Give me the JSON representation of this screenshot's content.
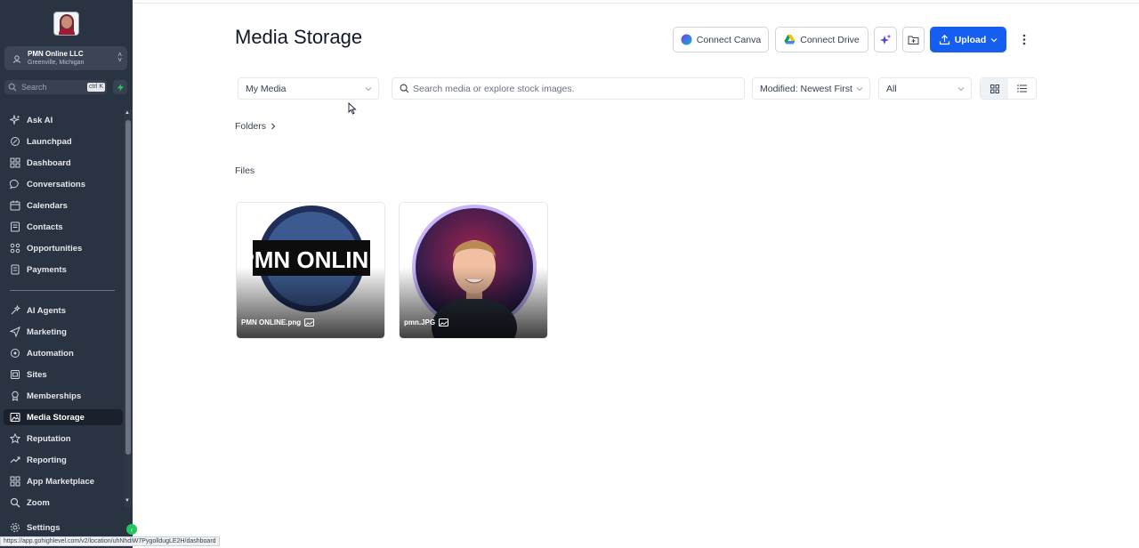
{
  "sidebar": {
    "account": {
      "name": "PMN Online LLC",
      "location": "Greenville, Michigan"
    },
    "search": {
      "placeholder": "Search",
      "shortcut": "ctrl K"
    },
    "nav": [
      {
        "label": "Ask AI",
        "icon": "sparkle-icon"
      },
      {
        "label": "Launchpad",
        "icon": "rocket-icon"
      },
      {
        "label": "Dashboard",
        "icon": "grid-icon"
      },
      {
        "label": "Conversations",
        "icon": "chat-icon"
      },
      {
        "label": "Calendars",
        "icon": "calendar-icon"
      },
      {
        "label": "Contacts",
        "icon": "contacts-icon"
      },
      {
        "label": "Opportunities",
        "icon": "opportunities-icon"
      },
      {
        "label": "Payments",
        "icon": "payments-icon"
      }
    ],
    "nav2": [
      {
        "label": "AI Agents",
        "icon": "ai-agents-icon"
      },
      {
        "label": "Marketing",
        "icon": "send-icon"
      },
      {
        "label": "Automation",
        "icon": "automation-icon"
      },
      {
        "label": "Sites",
        "icon": "sites-icon"
      },
      {
        "label": "Memberships",
        "icon": "award-icon"
      },
      {
        "label": "Media Storage",
        "icon": "image-icon",
        "active": true
      },
      {
        "label": "Reputation",
        "icon": "star-icon"
      },
      {
        "label": "Reporting",
        "icon": "trend-icon"
      },
      {
        "label": "App Marketplace",
        "icon": "apps-icon"
      },
      {
        "label": "Zoom",
        "icon": "zoom-icon"
      }
    ],
    "settings_label": "Settings"
  },
  "status_url": "https://app.gohighlevel.com/v2/location/uhNhdiW7PygolldugLE2H/dashboard",
  "page": {
    "title": "Media Storage",
    "toolbar": {
      "connect_canva": "Connect Canva",
      "connect_drive": "Connect Drive",
      "upload": "Upload"
    },
    "filters": {
      "source": "My Media",
      "search_placeholder": "Search media or explore stock images.",
      "sort": "Modified: Newest First",
      "type": "All"
    },
    "folders_label": "Folders",
    "files_label": "Files",
    "files": [
      {
        "name": "PMN ONLINE.png",
        "logo_text": "PMN ONLINE"
      },
      {
        "name": "pmn.JPG"
      }
    ]
  },
  "colors": {
    "sidebar_bg": "#2a3341",
    "accent": "#155eef",
    "active_item": "#1a212c"
  }
}
